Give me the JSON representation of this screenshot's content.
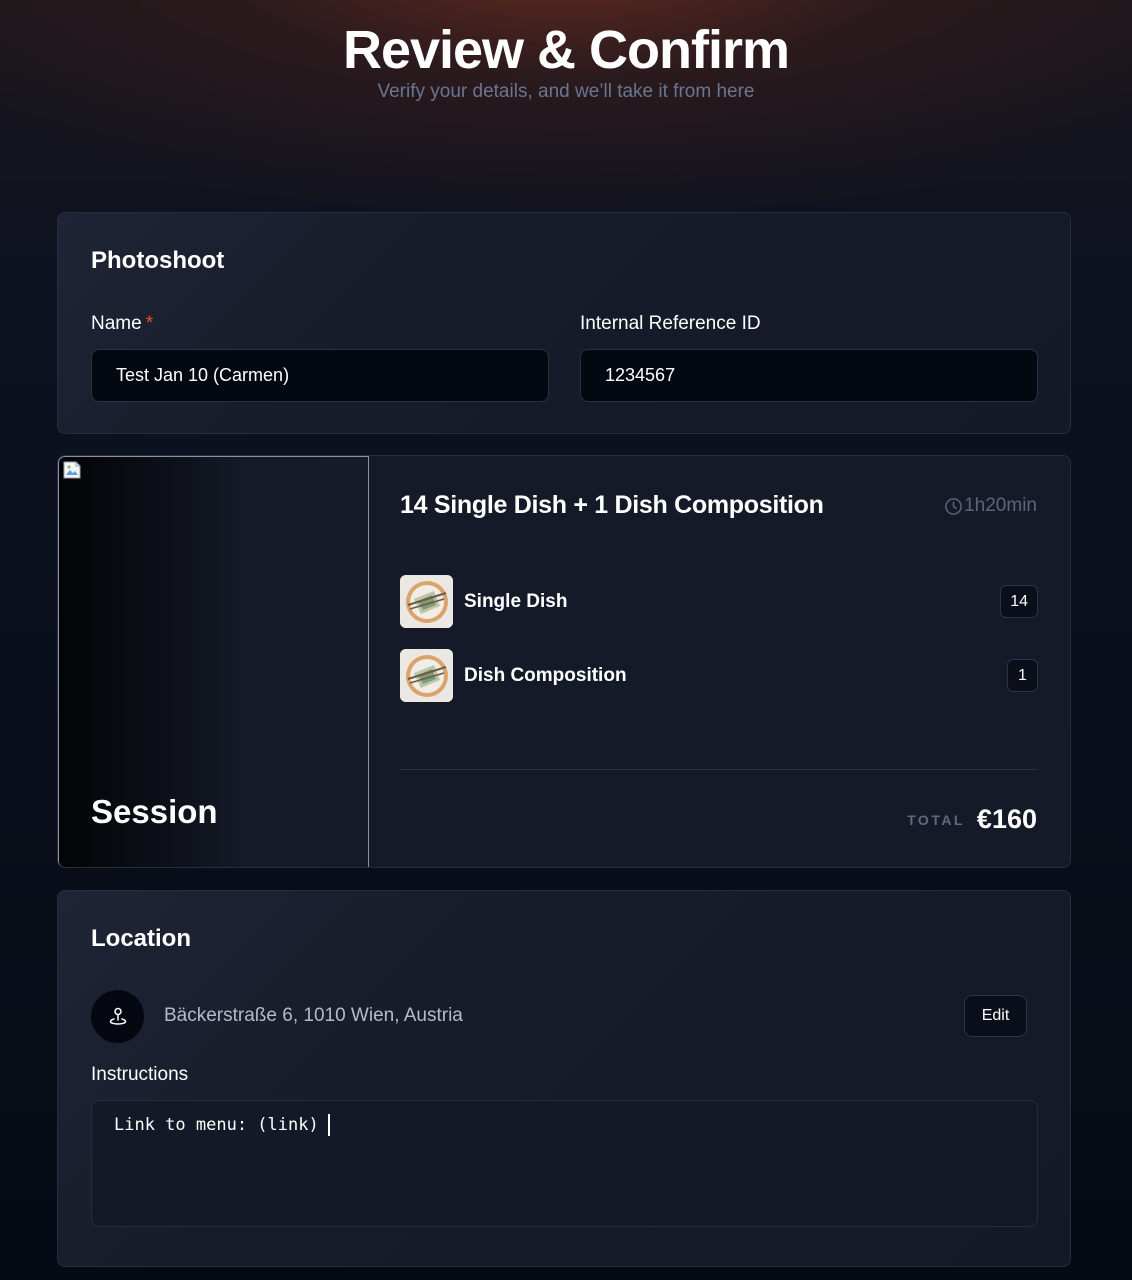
{
  "header": {
    "title": "Review & Confirm",
    "subtitle": "Verify your details, and we’ll take it from here"
  },
  "photoshoot": {
    "title": "Photoshoot",
    "name_label": "Name",
    "required_mark": "*",
    "name_value": "Test Jan 10 (Carmen)",
    "reference_label": "Internal Reference ID",
    "reference_value": "1234567"
  },
  "session": {
    "image_label": "Session",
    "package_title": "14 Single Dish + 1 Dish Composition",
    "duration": "1h20min",
    "items": [
      {
        "name": "Single Dish",
        "quantity": "14"
      },
      {
        "name": "Dish Composition",
        "quantity": "1"
      }
    ],
    "total_label": "TOTAL",
    "total_value": "€160"
  },
  "location": {
    "title": "Location",
    "address": "Bäckerstraße 6, 1010 Wien, Austria",
    "edit_label": "Edit",
    "instructions_label": "Instructions",
    "instructions_value": "Link to menu: (link)"
  },
  "icons": {
    "duration": "clock-icon",
    "location": "map-pin-icon",
    "broken_image": "broken-image-icon",
    "dish_thumbnail": "dish-photo"
  },
  "colors": {
    "required": "#e8502a",
    "background": "#060a14",
    "card": "#171c2a",
    "muted_text": "#6b7590"
  }
}
